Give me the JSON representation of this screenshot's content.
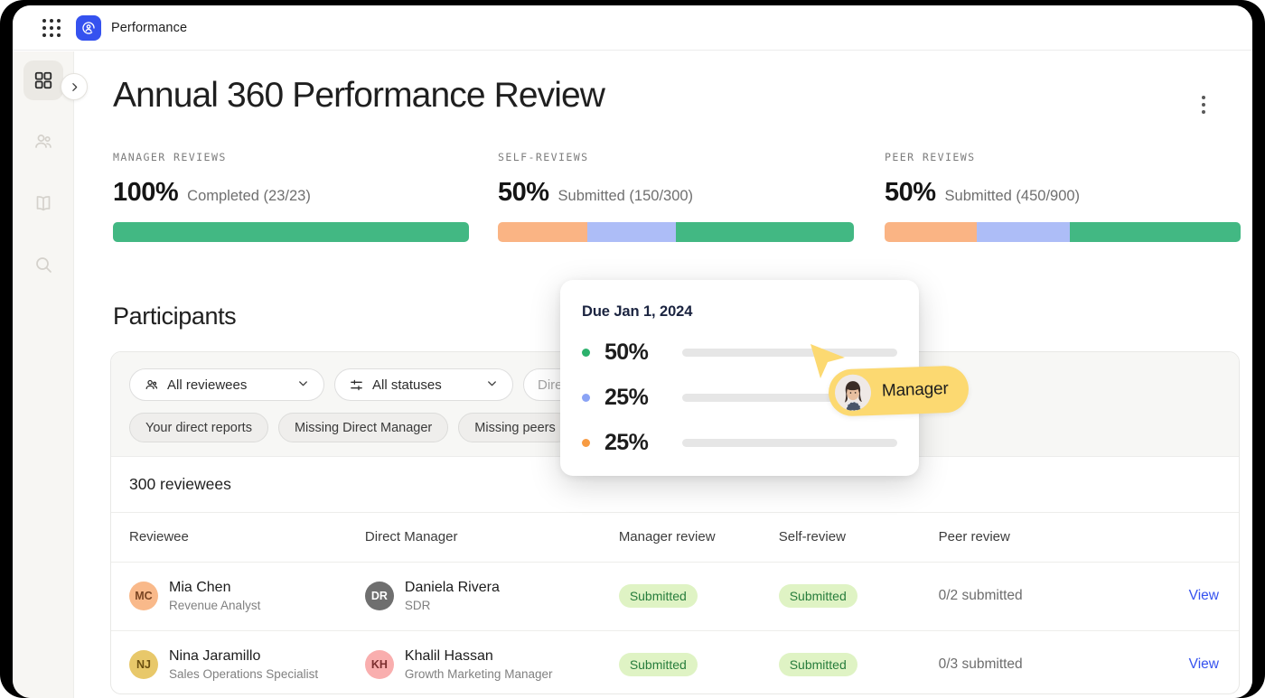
{
  "topbar": {
    "apps_icon": "apps-grid-icon",
    "logo_icon": "performance-logo-icon",
    "app_name": "Performance"
  },
  "rail": {
    "items": [
      {
        "icon": "dashboard-grid-icon",
        "active": true
      },
      {
        "icon": "people-icon",
        "active": false
      },
      {
        "icon": "book-icon",
        "active": false
      },
      {
        "icon": "search-icon",
        "active": false
      }
    ],
    "expand_icon": "chevron-right-icon"
  },
  "header": {
    "title": "Annual 360 Performance Review",
    "menu_icon": "kebab-menu-icon"
  },
  "stats": [
    {
      "label": "MANAGER REVIEWS",
      "percent": "100%",
      "subtitle": "Completed (23/23)",
      "segments": [
        {
          "name": "completed",
          "color": "#42b883",
          "width": 100
        }
      ]
    },
    {
      "label": "SELF-REVIEWS",
      "percent": "50%",
      "subtitle": "Submitted (150/300)",
      "segments": [
        {
          "name": "not-started",
          "color": "#fab484",
          "width": 25
        },
        {
          "name": "in-progress",
          "color": "#adbdf7",
          "width": 25
        },
        {
          "name": "submitted",
          "color": "#42b883",
          "width": 50
        }
      ]
    },
    {
      "label": "PEER REVIEWS",
      "percent": "50%",
      "subtitle": "Submitted (450/900)",
      "segments": [
        {
          "name": "not-started",
          "color": "#fab484",
          "width": 26
        },
        {
          "name": "in-progress",
          "color": "#adbdf7",
          "width": 26
        },
        {
          "name": "submitted",
          "color": "#42b883",
          "width": 48
        }
      ]
    }
  ],
  "tooltip": {
    "title": "Due Jan 1, 2024",
    "rows": [
      {
        "value": "50%",
        "color": "#2cb16c"
      },
      {
        "value": "25%",
        "color": "#8aa3f5"
      },
      {
        "value": "25%",
        "color": "#f79b42"
      }
    ]
  },
  "cursor": {
    "label": "Manager",
    "color": "#fcd971",
    "avatar_icon": "user-photo-avatar"
  },
  "participants": {
    "title": "Participants",
    "filters": [
      {
        "name": "reviewees",
        "icon": "people-icon",
        "value": "All reviewees",
        "chevron": "chevron-down-icon"
      },
      {
        "name": "statuses",
        "icon": "sliders-icon",
        "value": "All statuses",
        "chevron": "chevron-down-icon"
      },
      {
        "name": "direct-manager",
        "icon": "",
        "value": "Direct Manager",
        "chevron": ""
      }
    ],
    "chips": [
      "Your direct reports",
      "Missing Direct Manager",
      "Missing peers"
    ],
    "count_label": "300 reviewees",
    "columns": [
      "Reviewee",
      "Direct Manager",
      "Manager review",
      "Self-review",
      "Peer review",
      ""
    ],
    "rows": [
      {
        "reviewee": {
          "initials": "MC",
          "name": "Mia Chen",
          "role": "Revenue Analyst",
          "avatar_color": "#f9b98a",
          "initials_color": "#7a4523"
        },
        "manager": {
          "initials": "DR",
          "name": "Daniela Rivera",
          "role": "SDR",
          "avatar_color": "#6f6f6f",
          "initials_color": "#ffffff"
        },
        "manager_review": "Submitted",
        "self_review": "Submitted",
        "peer_review": "0/2 submitted",
        "action": "View"
      },
      {
        "reviewee": {
          "initials": "NJ",
          "name": "Nina Jaramillo",
          "role": "Sales Operations Specialist",
          "avatar_color": "#e6c košt",
          "initials_color": "#6b4f10"
        },
        "manager": {
          "initials": "KH",
          "name": "Khalil Hassan",
          "role": "Growth Marketing Manager",
          "avatar_color": "#f9aeae",
          "initials_color": "#7c2f2f"
        },
        "manager_review": "Submitted",
        "self_review": "Submitted",
        "peer_review": "0/3 submitted",
        "action": "View"
      }
    ]
  },
  "colors": {
    "accent": "#3552ef",
    "green": "#42b883",
    "orange": "#fab484",
    "blue": "#adbdf7",
    "badge_bg": "#dff3c4",
    "badge_text": "#277d3c"
  }
}
